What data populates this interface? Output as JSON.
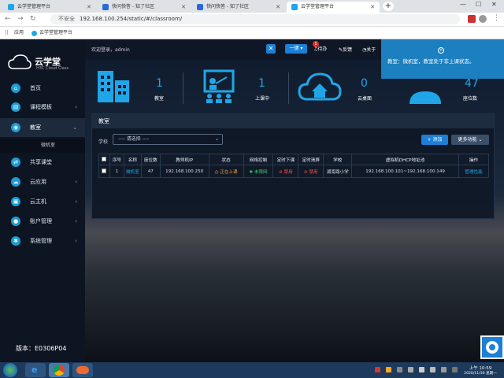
{
  "browser": {
    "tabs": [
      {
        "title": "云学堂管理平台",
        "active": false
      },
      {
        "title": "快问快答 - 知了社区",
        "active": false
      },
      {
        "title": "快问快答 - 知了社区",
        "active": false
      },
      {
        "title": "云学堂管理平台",
        "active": true
      }
    ],
    "url_security": "不安全",
    "url": "192.168.100.254/static/#/classroom/",
    "bookmarks": [
      "应用",
      "云学堂管理平台"
    ]
  },
  "app": {
    "logo_title": "云学堂",
    "logo_subtitle": "H3C Cloud Class",
    "welcome": "欢迎登录，admin",
    "one_click_label": "一键",
    "todo_label": "待办",
    "todo_badge": "1",
    "feedback_label": "反馈",
    "about_label": "关于",
    "version": "版本：E0306P04"
  },
  "sidebar": {
    "items": [
      {
        "label": "首页",
        "icon": "home-icon",
        "arrow": false
      },
      {
        "label": "课程模板",
        "icon": "book-icon",
        "arrow": true
      },
      {
        "label": "教室",
        "icon": "classroom-icon",
        "arrow": true,
        "active": true
      },
      {
        "label": "共享课堂",
        "icon": "share-icon",
        "arrow": false
      },
      {
        "label": "云应用",
        "icon": "cloud-app-icon",
        "arrow": true
      },
      {
        "label": "云主机",
        "icon": "server-icon",
        "arrow": true
      },
      {
        "label": "账户管理",
        "icon": "user-icon",
        "arrow": true
      },
      {
        "label": "系统管理",
        "icon": "gear-icon",
        "arrow": true
      }
    ],
    "submenu": "微机室"
  },
  "stats": [
    {
      "value": "1",
      "label": "教室"
    },
    {
      "value": "1",
      "label": "上课中"
    },
    {
      "value": "0",
      "label": "云桌面"
    },
    {
      "value": "47",
      "label": "座位数"
    }
  ],
  "panel": {
    "title": "教室",
    "school_label": "学校",
    "school_select": "---- 请选择 ----",
    "add_button": "+ 添加",
    "more_button": "更多功能"
  },
  "table": {
    "headers": [
      "序号",
      "名称",
      "座位数",
      "教师机IP",
      "状态",
      "网络控制",
      "定时下课",
      "定时清屏",
      "学校",
      "虚拟机DHCP地址池",
      "操作"
    ],
    "rows": [
      {
        "index": "1",
        "name": "微机室",
        "seats": "47",
        "ip": "192.168.100.250",
        "status": "正在上课",
        "network": "未限网",
        "timed_end": "禁用",
        "timed_clear": "禁用",
        "school": "湖南路小学",
        "dhcp": "192.168.100.101~192.168.100.149",
        "action": "管理性能"
      }
    ]
  },
  "popup": {
    "message": "教室：微机室，教室处于非上课状态。"
  },
  "taskbar": {
    "time": "上午 10:59",
    "date": "2020/11/30 星期一"
  },
  "colors": {
    "accent": "#1d7fd6",
    "icon_blue": "#1fa6e8",
    "status_orange": "#f0a030",
    "status_green": "#3bd06a",
    "status_red": "#ff5050"
  }
}
